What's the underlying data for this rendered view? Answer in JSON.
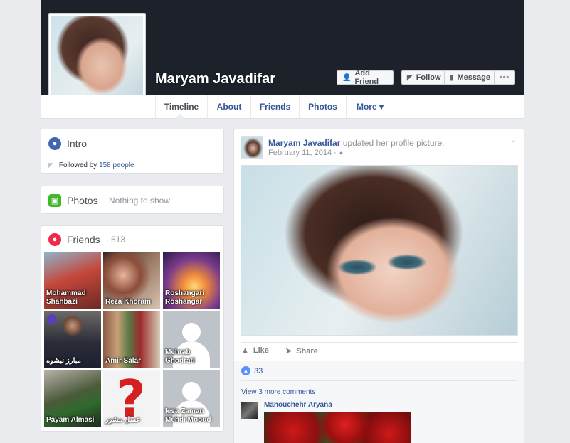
{
  "profile": {
    "name": "Maryam Javadifar"
  },
  "header_buttons": {
    "add_friend": "Add Friend",
    "follow": "Follow",
    "message": "Message",
    "more": "•••"
  },
  "tabs": [
    {
      "label": "Timeline",
      "active": true
    },
    {
      "label": "About"
    },
    {
      "label": "Friends"
    },
    {
      "label": "Photos"
    },
    {
      "label": "More ▾"
    }
  ],
  "intro": {
    "title": "Intro",
    "followed_by_prefix": "Followed by",
    "followed_by_link": "158 people"
  },
  "photos": {
    "title": "Photos",
    "subtitle": "· Nothing to show"
  },
  "friends": {
    "title": "Friends",
    "count": "· 513",
    "list": [
      {
        "name": "Mohammad Shahbazi"
      },
      {
        "name": "Reza Khoram"
      },
      {
        "name": "Roshangari Roshangar"
      },
      {
        "name": "مبارز نبشوه"
      },
      {
        "name": "Amir Salar"
      },
      {
        "name": "Mehrab Ghodrati"
      },
      {
        "name": "Payam Almasi"
      },
      {
        "name": "عسل مشور"
      },
      {
        "name": "Iesa Zaman Mehdi Mooud"
      }
    ]
  },
  "post": {
    "author": "Maryam Javadifar",
    "action_text": "updated her profile picture.",
    "date": "February 11, 2014 ·",
    "like_label": "Like",
    "share_label": "Share",
    "like_count": "33",
    "view_more_comments": "View 3 more comments",
    "commenter": "Manouchehr Aryana"
  },
  "colors": {
    "cover": "#1d2129",
    "link": "#365899",
    "intro_icon": "#4267b2",
    "photos_icon": "#42b72a",
    "friends_icon": "#f02849"
  }
}
